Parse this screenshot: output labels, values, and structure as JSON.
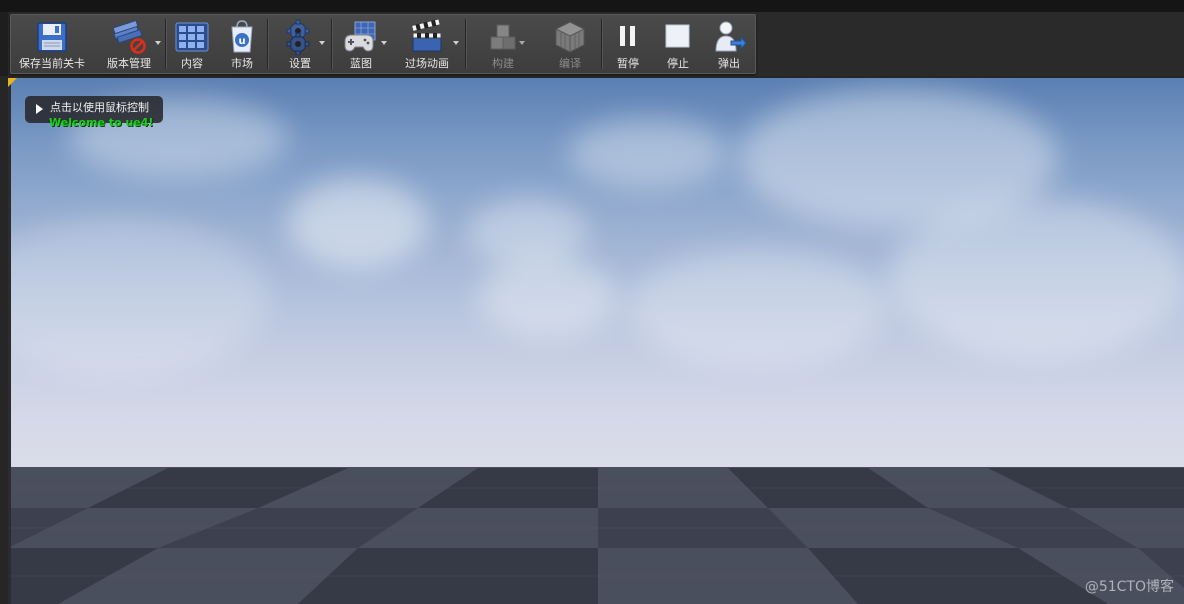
{
  "toolbar": {
    "buttons": [
      {
        "id": "save",
        "label": "保存当前关卡",
        "icon": "save-floppy-icon",
        "dropdown": false,
        "enabled": true
      },
      {
        "id": "source-control",
        "label": "版本管理",
        "icon": "source-control-icon",
        "dropdown": true,
        "enabled": true
      },
      {
        "id": "content",
        "label": "内容",
        "icon": "content-browser-icon",
        "dropdown": false,
        "enabled": true
      },
      {
        "id": "marketplace",
        "label": "市场",
        "icon": "marketplace-icon",
        "dropdown": false,
        "enabled": true
      },
      {
        "id": "settings",
        "label": "设置",
        "icon": "settings-gear-icon",
        "dropdown": true,
        "enabled": true
      },
      {
        "id": "blueprint",
        "label": "蓝图",
        "icon": "blueprint-gamepad-icon",
        "dropdown": true,
        "enabled": true
      },
      {
        "id": "cinematics",
        "label": "过场动画",
        "icon": "clapperboard-icon",
        "dropdown": true,
        "enabled": true
      },
      {
        "id": "build",
        "label": "构建",
        "icon": "build-blocks-icon",
        "dropdown": true,
        "enabled": false
      },
      {
        "id": "compile",
        "label": "编译",
        "icon": "compile-cube-icon",
        "dropdown": false,
        "enabled": false
      },
      {
        "id": "pause",
        "label": "暂停",
        "icon": "pause-icon",
        "dropdown": false,
        "enabled": true
      },
      {
        "id": "stop",
        "label": "停止",
        "icon": "stop-icon",
        "dropdown": false,
        "enabled": true
      },
      {
        "id": "eject",
        "label": "弹出",
        "icon": "eject-person-icon",
        "dropdown": false,
        "enabled": true
      }
    ]
  },
  "viewport": {
    "mouse_hint": "点击以使用鼠标控制",
    "welcome_message": "Welcome to ue4!",
    "colors": {
      "sky_top": "#5a7fb2",
      "sky_horizon": "#dadce9",
      "floor": "#3d414f",
      "welcome_text": "#19d019",
      "corner_marker": "#e8b51b"
    }
  },
  "watermark": "@51CTO博客"
}
